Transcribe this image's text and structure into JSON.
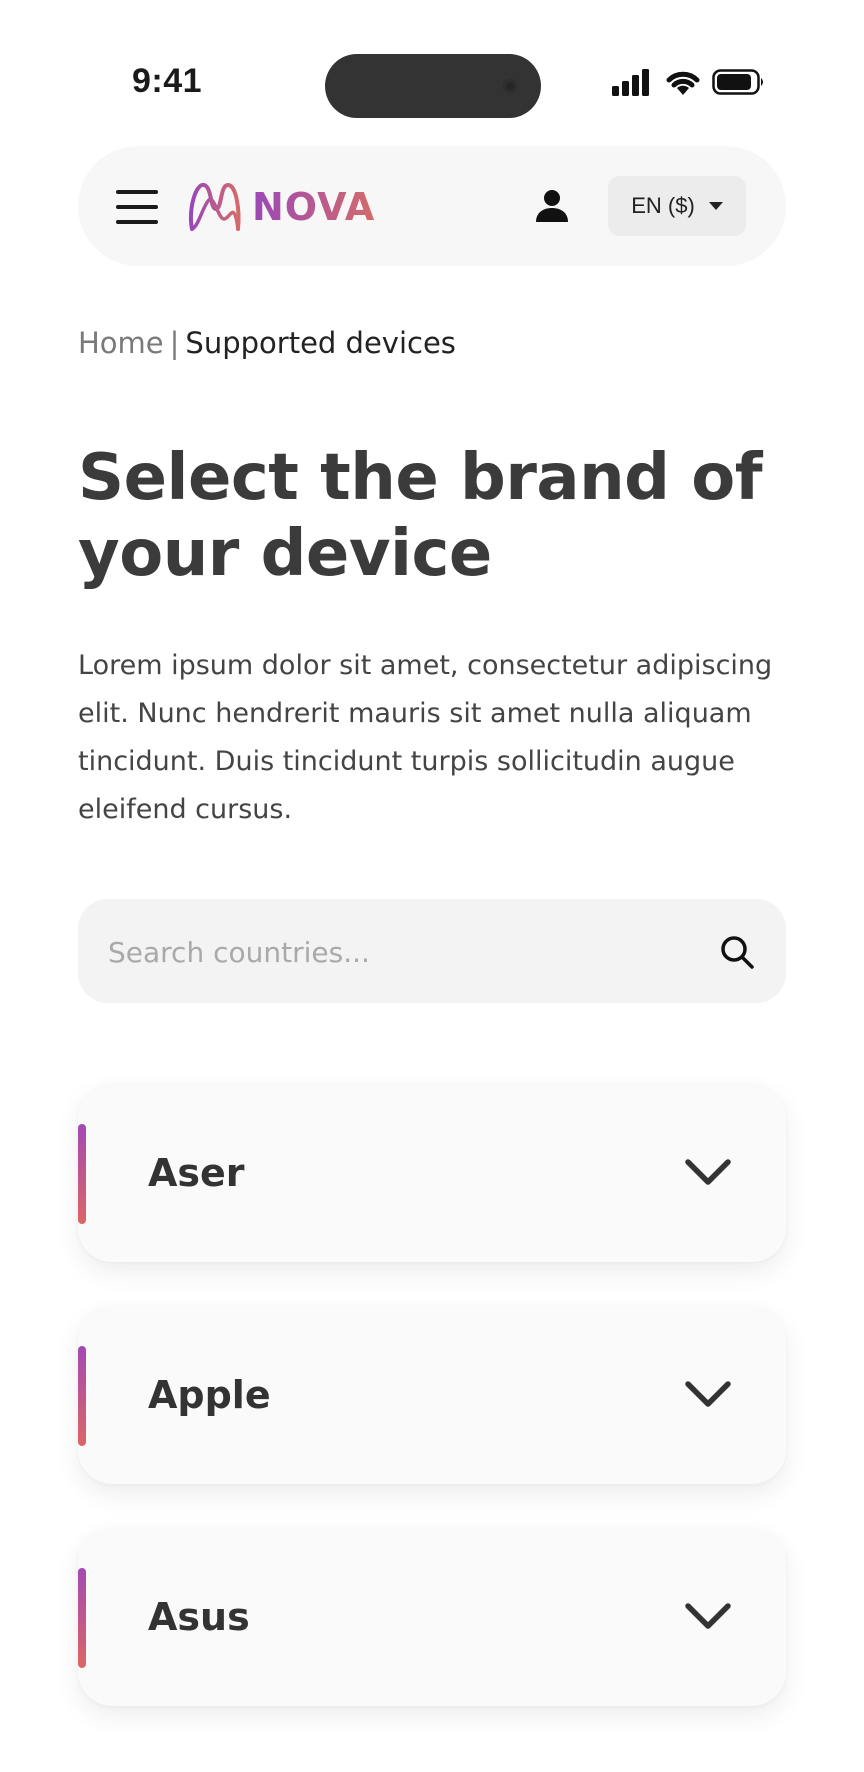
{
  "status_bar": {
    "time": "9:41"
  },
  "header": {
    "brand_name": "NOVA",
    "brand_colors": [
      "#9a48b8",
      "#d46a6a"
    ],
    "language_label": "EN ($)",
    "icons": [
      "menu-icon",
      "user-icon",
      "caret-down-icon"
    ]
  },
  "breadcrumb": {
    "home": "Home",
    "separator": "|",
    "current": "Supported devices"
  },
  "page": {
    "title": "Select the brand of your device",
    "description": "Lorem ipsum dolor sit amet, consectetur adipiscing elit. Nunc hendrerit mauris sit amet nulla aliquam tincidunt. Duis tincidunt turpis sollicitudin augue eleifend cursus."
  },
  "search": {
    "placeholder": "Search countries...",
    "value": ""
  },
  "brands": [
    {
      "name": "Aser"
    },
    {
      "name": "Apple"
    },
    {
      "name": "Asus"
    }
  ]
}
